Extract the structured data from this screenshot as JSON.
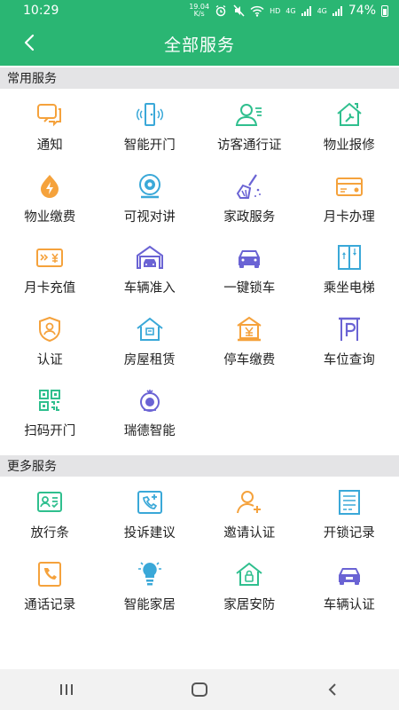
{
  "status_bar": {
    "time": "10:29",
    "net_speed_top": "19.04",
    "net_speed_unit": "K/s",
    "hd_label": "HD",
    "signal1_label": "4G",
    "signal2_label": "4G",
    "battery": "74%"
  },
  "header": {
    "title": "全部服务"
  },
  "sections": {
    "common": {
      "title": "常用服务",
      "items": [
        {
          "label": "通知",
          "icon": "notification-icon"
        },
        {
          "label": "智能开门",
          "icon": "smart-door-icon"
        },
        {
          "label": "访客通行证",
          "icon": "visitor-pass-icon"
        },
        {
          "label": "物业报修",
          "icon": "property-repair-icon"
        },
        {
          "label": "物业缴费",
          "icon": "property-payment-icon"
        },
        {
          "label": "可视对讲",
          "icon": "video-intercom-icon"
        },
        {
          "label": "家政服务",
          "icon": "housekeeping-icon"
        },
        {
          "label": "月卡办理",
          "icon": "monthly-card-icon"
        },
        {
          "label": "月卡充值",
          "icon": "card-recharge-icon"
        },
        {
          "label": "车辆准入",
          "icon": "vehicle-access-icon"
        },
        {
          "label": "一键锁车",
          "icon": "lock-car-icon"
        },
        {
          "label": "乘坐电梯",
          "icon": "elevator-icon"
        },
        {
          "label": "认证",
          "icon": "certification-icon"
        },
        {
          "label": "房屋租赁",
          "icon": "house-rental-icon"
        },
        {
          "label": "停车缴费",
          "icon": "parking-payment-icon"
        },
        {
          "label": "车位查询",
          "icon": "parking-query-icon"
        },
        {
          "label": "扫码开门",
          "icon": "qr-code-icon"
        },
        {
          "label": "瑞德智能",
          "icon": "ruide-smart-icon"
        }
      ]
    },
    "more": {
      "title": "更多服务",
      "items": [
        {
          "label": "放行条",
          "icon": "release-slip-icon"
        },
        {
          "label": "投诉建议",
          "icon": "complaint-icon"
        },
        {
          "label": "邀请认证",
          "icon": "invite-user-icon"
        },
        {
          "label": "开锁记录",
          "icon": "unlock-record-icon"
        },
        {
          "label": "通话记录",
          "icon": "call-record-icon"
        },
        {
          "label": "智能家居",
          "icon": "smart-home-icon"
        },
        {
          "label": "家居安防",
          "icon": "home-security-icon"
        },
        {
          "label": "车辆认证",
          "icon": "car-certification-icon"
        }
      ]
    }
  },
  "colors": {
    "primary": "#2ab673",
    "orange": "#f5a23c",
    "blue": "#3aa8d8",
    "green": "#2fbf8e",
    "purple": "#6a63d4"
  }
}
